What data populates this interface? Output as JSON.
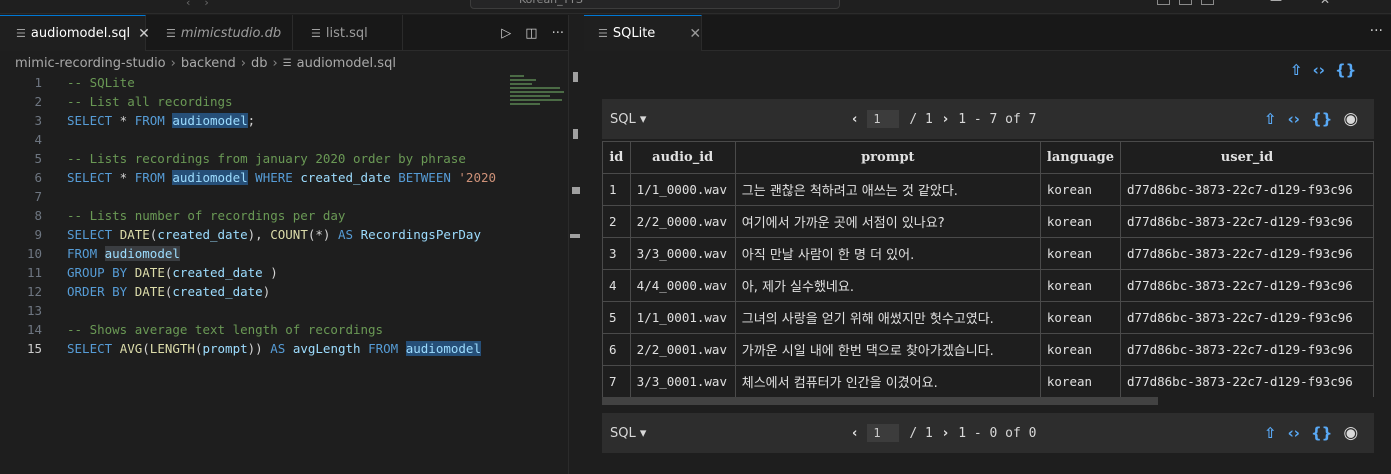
{
  "titlebar": {
    "search_text": "Korean_TTS"
  },
  "left_tabs": [
    {
      "label": "audiomodel.sql",
      "close": "✕"
    },
    {
      "label": "mimicstudio.db"
    },
    {
      "label": "list.sql"
    }
  ],
  "editor_actions": {
    "run": "▷",
    "split": "◫",
    "more": "···"
  },
  "breadcrumb": [
    "mimic-recording-studio",
    "backend",
    "db",
    "audiomodel.sql"
  ],
  "code_lines": [
    "1",
    "2",
    "3",
    "4",
    "5",
    "6",
    "7",
    "8",
    "9",
    "10",
    "11",
    "12",
    "13",
    "14",
    "15"
  ],
  "code": {
    "l1": "-- SQLite",
    "l2": "-- List all recordings",
    "l3a": "SELECT",
    "l3b": " * ",
    "l3c": "FROM",
    "l3d": "audiomodel",
    "l3e": ";",
    "l5": "-- Lists recordings from january 2020 order by phrase",
    "l6a": "SELECT",
    "l6b": " * ",
    "l6c": "FROM",
    "l6d": "audiomodel",
    "l6e": "WHERE",
    "l6f": "created_date",
    "l6g": "BETWEEN",
    "l6h": "'2020",
    "l8": "-- Lists number of recordings per day",
    "l9a": "SELECT",
    "l9b": "DATE",
    "l9c": "(",
    "l9d": "created_date",
    "l9e": "), ",
    "l9f": "COUNT",
    "l9g": "(*) ",
    "l9h": "AS",
    "l9i": "RecordingsPerDay",
    "l10a": "FROM",
    "l10b": "audiomodel",
    "l11a": "GROUP BY",
    "l11b": "DATE",
    "l11c": "(",
    "l11d": "created_date",
    "l11e": " )",
    "l12a": "ORDER BY",
    "l12b": "DATE",
    "l12c": "(",
    "l12d": "created_date",
    "l12e": ")",
    "l14": "-- Shows average text length of recordings",
    "l15a": "SELECT",
    "l15b": "AVG",
    "l15c": "(",
    "l15d": "LENGTH",
    "l15e": "(",
    "l15f": "prompt",
    "l15g": ")) ",
    "l15h": "AS",
    "l15i": "avgLength",
    "l15j": "FROM",
    "l15k": "audiomodel"
  },
  "right_tab": {
    "label": "SQLite",
    "close": "✕"
  },
  "right_more": "···",
  "top_actions": {
    "export": "⇧",
    "code": "‹›",
    "braces": "{}"
  },
  "result_toolbar": {
    "sql_label": "SQL ▾",
    "prev": "‹",
    "next": "›",
    "page": "1",
    "page_total": "/ 1",
    "range": "1 - 7 of 7"
  },
  "result_toolbar2": {
    "sql_label": "SQL ▾",
    "prev": "‹",
    "next": "›",
    "page": "1",
    "page_total": "/ 1",
    "range": "1 - 0 of 0"
  },
  "table": {
    "columns": [
      "id",
      "audio_id",
      "prompt",
      "language",
      "user_id"
    ],
    "rows": [
      [
        "1",
        "1/1_0000.wav",
        "그는 괜찮은 척하려고 애쓰는 것 같았다.",
        "korean",
        "d77d86bc-3873-22c7-d129-f93c96"
      ],
      [
        "2",
        "2/2_0000.wav",
        "여기에서 가까운 곳에 서점이 있나요?",
        "korean",
        "d77d86bc-3873-22c7-d129-f93c96"
      ],
      [
        "3",
        "3/3_0000.wav",
        "아직 만날 사람이 한 명 더 있어.",
        "korean",
        "d77d86bc-3873-22c7-d129-f93c96"
      ],
      [
        "4",
        "4/4_0000.wav",
        "아, 제가 실수했네요.",
        "korean",
        "d77d86bc-3873-22c7-d129-f93c96"
      ],
      [
        "5",
        "1/1_0001.wav",
        "그녀의 사랑을 얻기 위해 애썼지만 헛수고였다.",
        "korean",
        "d77d86bc-3873-22c7-d129-f93c96"
      ],
      [
        "6",
        "2/2_0001.wav",
        "가까운 시일 내에 한번 댁으로 찾아가겠습니다.",
        "korean",
        "d77d86bc-3873-22c7-d129-f93c96"
      ],
      [
        "7",
        "3/3_0001.wav",
        "체스에서 컴퓨터가 인간을 이겼어요.",
        "korean",
        "d77d86bc-3873-22c7-d129-f93c96"
      ]
    ]
  }
}
